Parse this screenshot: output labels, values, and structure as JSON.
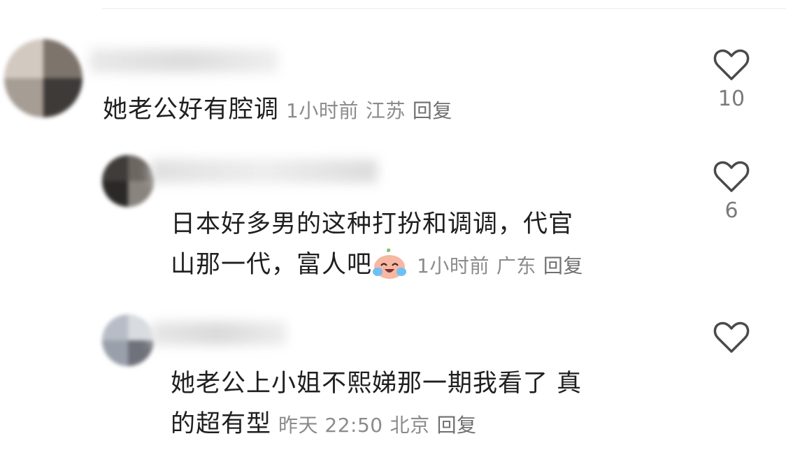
{
  "comments": [
    {
      "text": "她老公好有腔调",
      "time": "1小时前",
      "location": "江苏",
      "reply_label": "回复",
      "like_count": "10"
    },
    {
      "text_line1": "日本好多男的这种打扮和调调，代官",
      "text_line2": "山那一代，富人吧",
      "emoji": "crying-laughing-face-icon",
      "time": "1小时前",
      "location": "广东",
      "reply_label": "回复",
      "like_count": "6"
    },
    {
      "text_line1": "她老公上小姐不熙娣那一期我看了 真",
      "text_line2": "的超有型",
      "time": "昨天 22:50",
      "location": "北京",
      "reply_label": "回复",
      "like_count": ""
    }
  ],
  "colors": {
    "text": "#1f1f1f",
    "meta": "#8b8b8b",
    "heart_outline": "#4a4a4a"
  }
}
